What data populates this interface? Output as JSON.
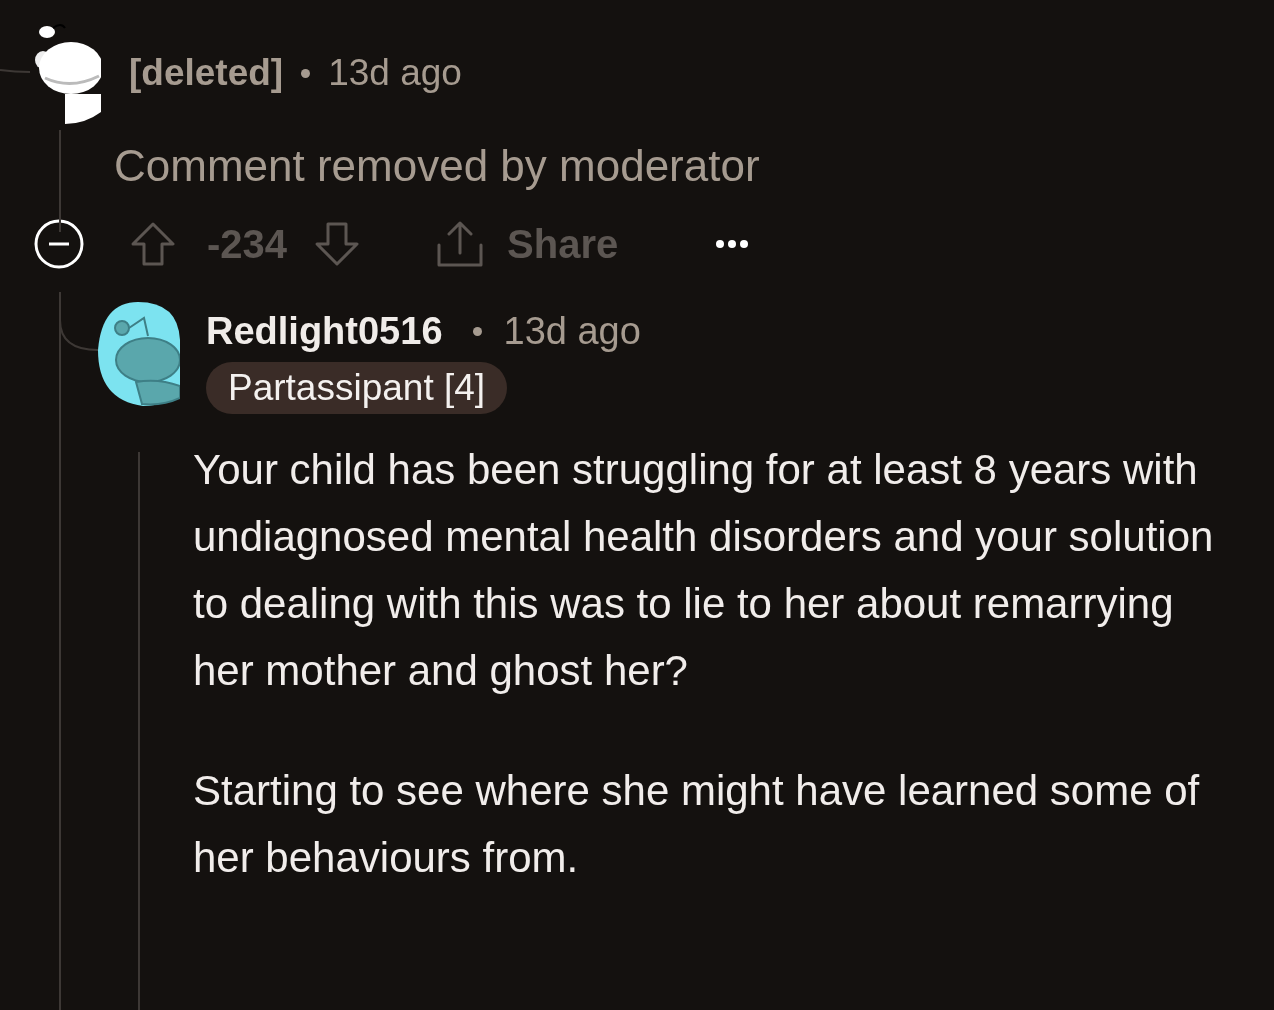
{
  "parent": {
    "author": "[deleted]",
    "time": "13d ago",
    "body": "Comment removed by moderator",
    "score": "-234",
    "share_label": "Share"
  },
  "reply": {
    "author": "Redlight0516",
    "time": "13d ago",
    "flair": "Partassipant [4]",
    "body": [
      "Your child has been struggling for at least 8 years with undiagnosed mental health disorders and your solution to dealing with this was to lie to her about remarrying her mother and ghost her?",
      "Starting to see where she might have learned some of her behaviours from."
    ]
  }
}
